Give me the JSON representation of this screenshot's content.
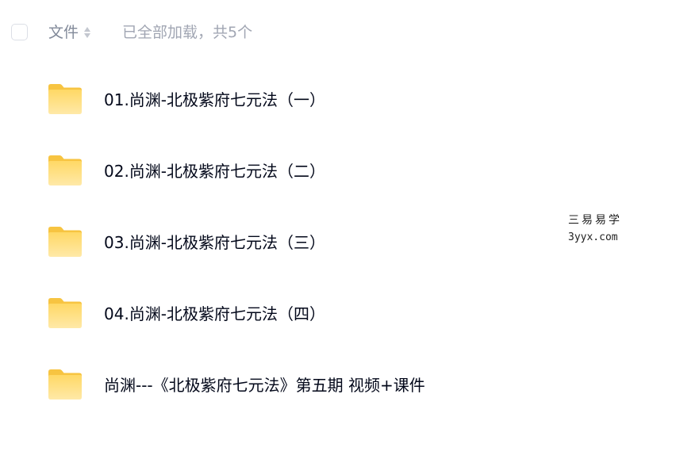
{
  "header": {
    "column_label": "文件",
    "load_status": "已全部加载，共5个"
  },
  "folders": [
    {
      "name": "01.尚渊-北极紫府七元法（一）",
      "icon": "folder-icon"
    },
    {
      "name": "02.尚渊-北极紫府七元法（二）",
      "icon": "folder-icon"
    },
    {
      "name": "03.尚渊-北极紫府七元法（三）",
      "icon": "folder-icon"
    },
    {
      "name": "04.尚渊-北极紫府七元法（四）",
      "icon": "folder-icon"
    },
    {
      "name": "尚渊---《北极紫府七元法》第五期 视频+课件",
      "icon": "folder-icon"
    }
  ],
  "watermark": {
    "line1": "三易易学",
    "line2": "3yyx.com"
  },
  "colors": {
    "folder_top": "#ffd15a",
    "folder_bottom": "#ffe8a3",
    "text_primary": "#03081a",
    "text_secondary": "#818999",
    "text_muted": "#a1a6b3"
  }
}
